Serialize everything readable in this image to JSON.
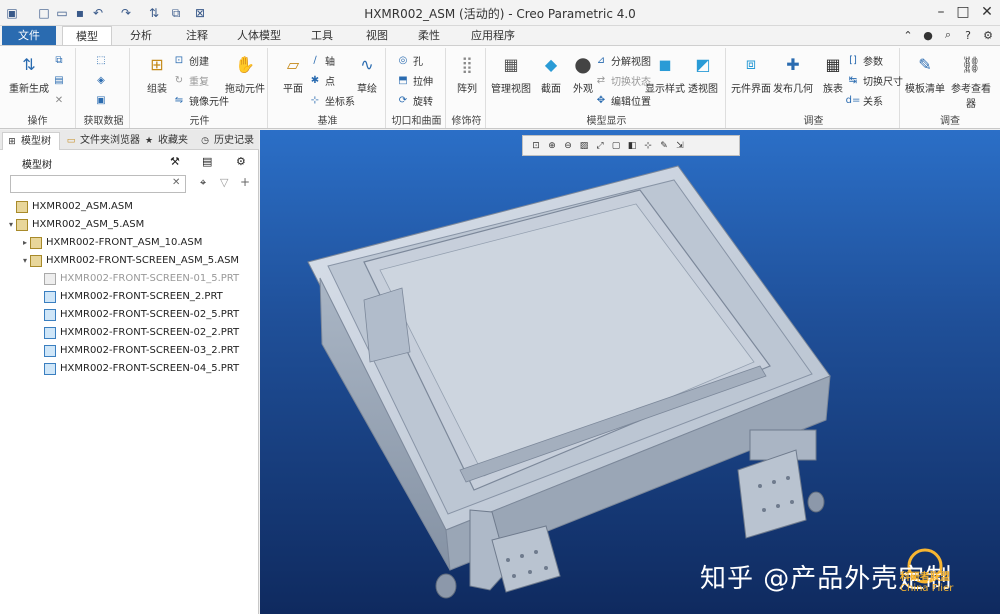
{
  "window": {
    "title": "HXMR002_ASM (活动的) - Creo Parametric 4.0",
    "quick_access_icons": [
      "app-icon",
      "new-icon",
      "open-icon",
      "save-icon",
      "undo-icon",
      "redo-icon",
      "regenerate-icon",
      "windows-icon",
      "close-icon"
    ]
  },
  "ribbon": {
    "tabs": [
      "文件",
      "模型",
      "分析",
      "注释",
      "人体模型",
      "工具",
      "视图",
      "柔性",
      "应用程序"
    ],
    "active_tab": "模型",
    "groups": {
      "operations": {
        "label": "操作",
        "regen": "重新生成"
      },
      "get_data": {
        "label": "获取数据"
      },
      "component": {
        "label": "元件",
        "assemble": "组装",
        "create": "创建",
        "repeat": "重复",
        "replace": "镜像元件",
        "drag": "拖动元件"
      },
      "datum": {
        "label": "基准",
        "plane": "平面",
        "axis": "轴",
        "point": "点",
        "csys": "坐标系",
        "sketch": "草绘"
      },
      "cut_surface": {
        "label": "切口和曲面",
        "hole": "孔",
        "extrude": "拉伸",
        "revolve": "旋转"
      },
      "modifiers": {
        "label": "修饰符",
        "pattern": "阵列"
      },
      "model_display": {
        "label": "模型显示",
        "manage_views": "管理视图",
        "section": "截面",
        "appearance": "外观",
        "exploded": "分解视图",
        "edit_pos": "编辑位置",
        "toggle_status": "切换状态",
        "display_style": "显示样式",
        "perspective": "透视图"
      },
      "investigate": {
        "label": "调查",
        "bill": "元件界面",
        "geometry": "发布几何",
        "family": "族表",
        "params": "参数",
        "switch_dims": "切换尺寸",
        "relations": "关系"
      },
      "intent": {
        "label": "调查",
        "ref_viewer": "参考查看器",
        "model_intent": "模板清单"
      }
    }
  },
  "panel": {
    "tabs": [
      "模型树",
      "文件夹浏览器",
      "收藏夹",
      "历史记录"
    ],
    "tree_label": "模型树",
    "search_placeholder": "",
    "tree": [
      {
        "label": "HXMR002_ASM.ASM",
        "level": 0,
        "type": "asm",
        "arrow": ""
      },
      {
        "label": "HXMR002_ASM_5.ASM",
        "level": 0,
        "type": "asm",
        "arrow": "▾"
      },
      {
        "label": "HXMR002-FRONT_ASM_10.ASM",
        "level": 1,
        "type": "asm",
        "arrow": "▸"
      },
      {
        "label": "HXMR002-FRONT-SCREEN_ASM_5.ASM",
        "level": 1,
        "type": "asm",
        "arrow": "▾"
      },
      {
        "label": "HXMR002-FRONT-SCREEN-01_5.PRT",
        "level": 2,
        "type": "supp",
        "arrow": ""
      },
      {
        "label": "HXMR002-FRONT-SCREEN_2.PRT",
        "level": 2,
        "type": "prt",
        "arrow": ""
      },
      {
        "label": "HXMR002-FRONT-SCREEN-02_5.PRT",
        "level": 2,
        "type": "prt",
        "arrow": ""
      },
      {
        "label": "HXMR002-FRONT-SCREEN-02_2.PRT",
        "level": 2,
        "type": "prt",
        "arrow": ""
      },
      {
        "label": "HXMR002-FRONT-SCREEN-03_2.PRT",
        "level": 2,
        "type": "prt",
        "arrow": ""
      },
      {
        "label": "HXMR002-FRONT-SCREEN-04_5.PRT",
        "level": 2,
        "type": "prt",
        "arrow": ""
      }
    ]
  },
  "graphics": {
    "watermark": "知乎 @产品外壳定制",
    "logo_cn": "科研者联盟",
    "logo_en": "China Flier",
    "view_toolbar_icons": [
      "refit-icon",
      "zoom-in-icon",
      "zoom-out-icon",
      "repaint-icon",
      "spin-center-icon",
      "saved-views-icon",
      "display-style-icon",
      "datum-display-icon",
      "annotation-icon",
      "exploded-icon"
    ]
  },
  "colors": {
    "file_tab": "#2a6bb0",
    "graphics_top": "#2b6fc7",
    "graphics_bottom": "#0f2a5f",
    "model": "#c9d2de"
  }
}
